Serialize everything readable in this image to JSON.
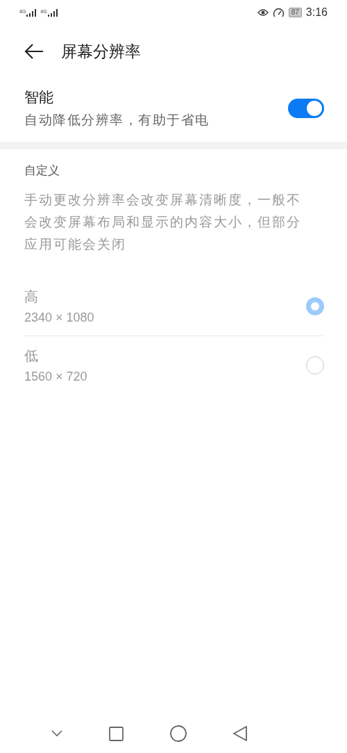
{
  "status_bar": {
    "signals": [
      "4G",
      "4G"
    ],
    "battery": "87",
    "time": "3:16"
  },
  "header": {
    "title": "屏幕分辨率"
  },
  "smart": {
    "title": "智能",
    "subtitle": "自动降低分辨率，有助于省电",
    "on": true
  },
  "custom": {
    "title": "自定义",
    "description": "手动更改分辨率会改变屏幕清晰度，一般不会改变屏幕布局和显示的内容大小，但部分应用可能会关闭",
    "disabled": true,
    "options": [
      {
        "label": "高",
        "resolution": "2340 × 1080",
        "selected": true
      },
      {
        "label": "低",
        "resolution": "1560 × 720",
        "selected": false
      }
    ]
  }
}
